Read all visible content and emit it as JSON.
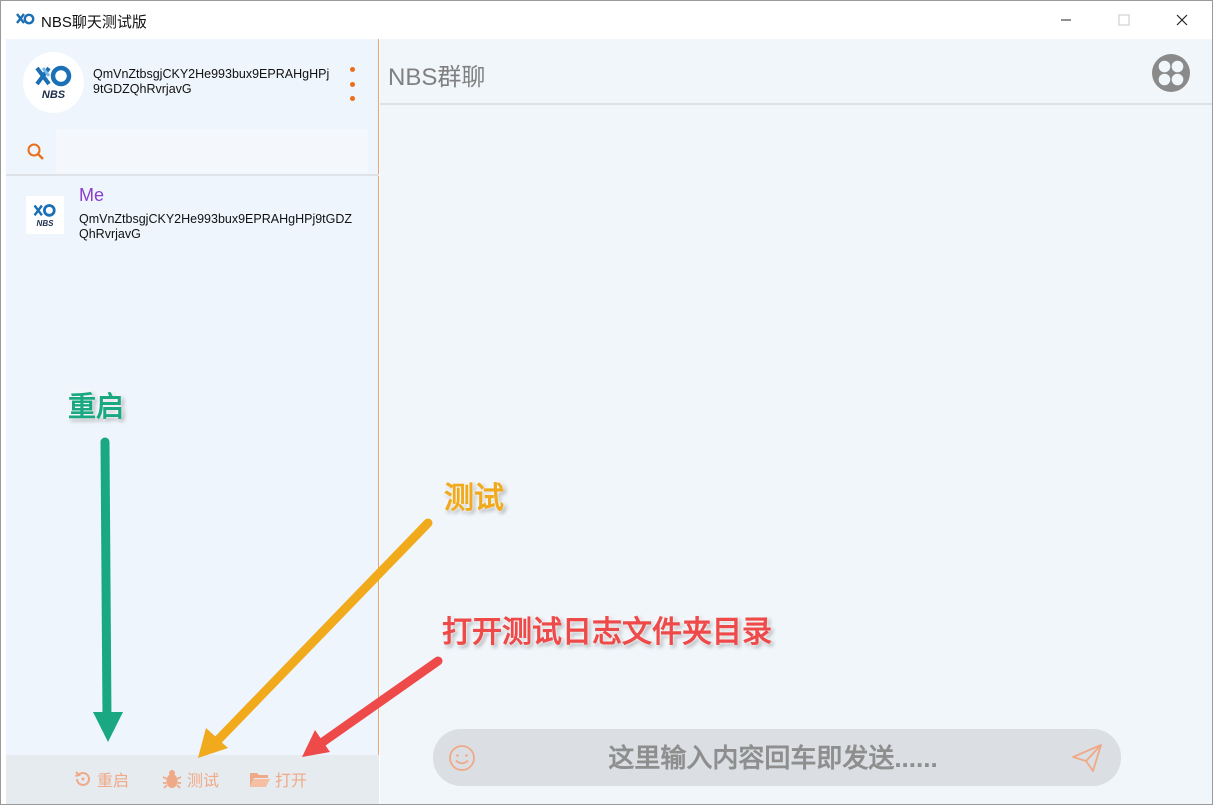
{
  "window": {
    "title": "NBS聊天测试版"
  },
  "profile": {
    "logo_text": "NBS",
    "peer_id": "QmVnZtbsgjCKY2He993bux9EPRAHgHPj9tGDZQhRvrjavG"
  },
  "search": {
    "value": "",
    "placeholder": ""
  },
  "contacts": [
    {
      "name": "Me",
      "logo_text": "NBS",
      "peer_id": "QmVnZtbsgjCKY2He993bux9EPRAHgHPj9tGDZQhRvrjavG"
    }
  ],
  "bottom_bar": {
    "restart_label": "重启",
    "test_label": "测试",
    "open_label": "打开"
  },
  "chat": {
    "title": "NBS群聊",
    "input_placeholder": "这里输入内容回车即发送......"
  },
  "annotations": {
    "restart": "重启",
    "test": "测试",
    "open": "打开测试日志文件夹目录"
  },
  "colors": {
    "accent": "#e8701c",
    "contact_name": "#8a3ecb",
    "anno_restart": "#1aa882",
    "anno_test": "#f0aa1c",
    "anno_open": "#ee4a4a"
  }
}
